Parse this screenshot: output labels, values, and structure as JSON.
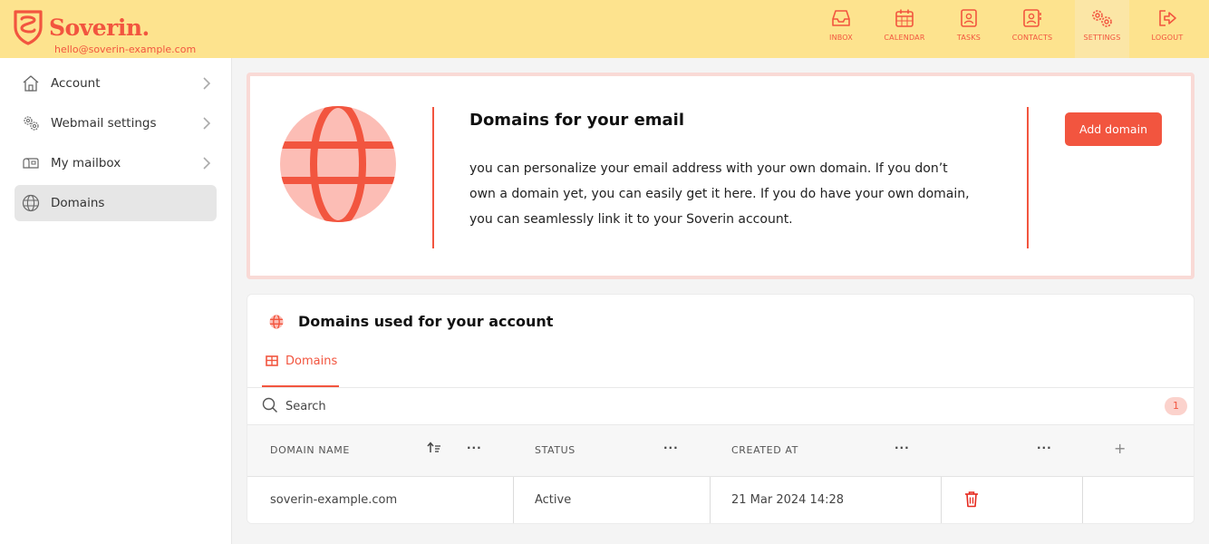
{
  "app": {
    "name": "Soverin.",
    "user_email": "hello@soverin-example.com"
  },
  "nav": [
    {
      "label": "INBOX",
      "icon": "inbox-icon"
    },
    {
      "label": "CALENDAR",
      "icon": "calendar-icon"
    },
    {
      "label": "TASKS",
      "icon": "tasks-icon"
    },
    {
      "label": "CONTACTS",
      "icon": "contacts-icon"
    },
    {
      "label": "SETTINGS",
      "icon": "settings-icon",
      "active": true
    },
    {
      "label": "LOGOUT",
      "icon": "logout-icon"
    }
  ],
  "sidebar": {
    "items": [
      {
        "label": "Account",
        "icon": "house-icon"
      },
      {
        "label": "Webmail settings",
        "icon": "gears-icon"
      },
      {
        "label": "My mailbox",
        "icon": "mailbox-icon"
      },
      {
        "label": "Domains",
        "icon": "globe-icon",
        "active": true
      }
    ]
  },
  "hero": {
    "title": "Domains for your email",
    "description": "you can personalize your email address with your own domain. If you don’t own a domain yet, you can easily get it here. If you do have your own domain, you can seamlessly link it to your Soverin account.",
    "add_button": "Add domain"
  },
  "domains": {
    "title": "Domains used for your account",
    "tab_label": "Domains",
    "search_placeholder": "Search",
    "count": "1",
    "columns": {
      "domain_name": "DOMAIN NAME",
      "status": "STATUS",
      "created_at": "CREATED AT",
      "menu": "···",
      "add_column": "+"
    },
    "rows": [
      {
        "domain_name": "soverin-example.com",
        "status": "Active",
        "created_at": "21 Mar 2024 14:28"
      }
    ]
  },
  "colors": {
    "accent": "#f2553f",
    "header_bg": "#fde38e",
    "globe_fill": "#fcbdb5"
  }
}
